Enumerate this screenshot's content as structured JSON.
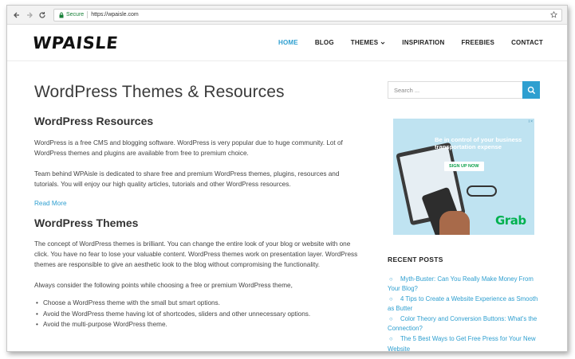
{
  "browser": {
    "secure_label": "Secure",
    "url": "https://wpaisle.com"
  },
  "site": {
    "logo": "WPAISLE",
    "nav": [
      {
        "label": "HOME",
        "active": true
      },
      {
        "label": "BLOG"
      },
      {
        "label": "THEMES",
        "has_dropdown": true
      },
      {
        "label": "INSPIRATION"
      },
      {
        "label": "FREEBIES"
      },
      {
        "label": "CONTACT"
      }
    ]
  },
  "main": {
    "title": "WordPress Themes & Resources",
    "resources_heading": "WordPress Resources",
    "resources_p1": "WordPress is a free CMS and blogging software. WordPress is very popular due to huge community. Lot of WordPress themes and plugins are available from free to premium choice.",
    "resources_p2": "Team behind WPAisle is dedicated to share free and premium WordPress themes, plugins, resources and tutorials. You will enjoy our high quality articles, tutorials and other WordPress resources.",
    "read_more": "Read More",
    "themes_heading": "WordPress Themes",
    "themes_p1": "The concept of WordPress themes is brilliant. You can change the entire look of your blog or website with one click. You have no fear to lose your valuable content. WordPress themes work on presentation layer. WordPress themes are responsible to give an aesthetic look to the blog without compromising the functionality.",
    "themes_p2": "Always consider the following points while choosing a free or premium WordPress theme,",
    "bullets": [
      "Choose a WordPress theme with the small but smart options.",
      "Avoid the WordPress theme having lot of shortcodes, sliders and other unnecessary options.",
      "Avoid the multi-purpose WordPress theme."
    ]
  },
  "sidebar": {
    "search_placeholder": "Search ...",
    "ad": {
      "headline": "Be in control of your business transportation expense",
      "cta": "SIGN UP NOW",
      "brand": "Grab",
      "badge": "i ×"
    },
    "recent_title": "RECENT POSTS",
    "recent_posts": [
      "Myth-Buster: Can You Really Make Money From Your Blog?",
      "4 Tips to Create a Website Experience as Smooth as Butter",
      "Color Theory and Conversion Buttons: What's the Connection?",
      "The 5 Best Ways to Get Free Press for Your New Website"
    ]
  },
  "colors": {
    "accent": "#2e9fd0",
    "text": "#444444",
    "ad_background": "#bfe3f1",
    "brand_green": "#00b14f"
  }
}
